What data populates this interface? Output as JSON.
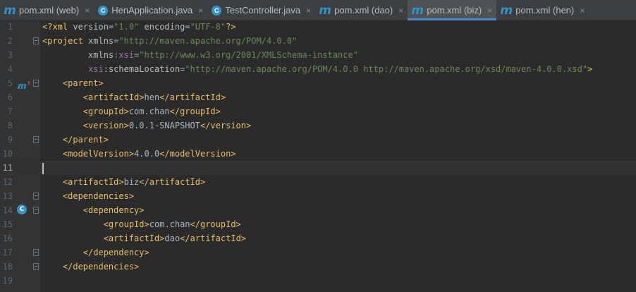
{
  "tabs": [
    {
      "label": "pom.xml (web)",
      "icon": "maven-icon",
      "active": false
    },
    {
      "label": "HenApplication.java",
      "icon": "spring-class-icon",
      "active": false
    },
    {
      "label": "TestController.java",
      "icon": "class-icon",
      "active": false
    },
    {
      "label": "pom.xml (dao)",
      "icon": "maven-icon",
      "active": false
    },
    {
      "label": "pom.xml (biz)",
      "icon": "maven-icon",
      "active": true
    },
    {
      "label": "pom.xml (hen)",
      "icon": "maven-icon",
      "active": false
    }
  ],
  "tab_close_glyph": "×",
  "tab_icon_m": "m",
  "tab_icon_c": "C",
  "current_line": 11,
  "line_numbers": [
    "1",
    "2",
    "3",
    "4",
    "5",
    "6",
    "7",
    "8",
    "9",
    "10",
    "11",
    "12",
    "13",
    "14",
    "15",
    "16",
    "17",
    "18",
    "19"
  ],
  "lines": {
    "l1": {
      "p1": "<?xml ",
      "a1": "version",
      "eq1": "=",
      "s1": "\"1.0\"",
      "a2": " encoding",
      "eq2": "=",
      "s2": "\"UTF-8\"",
      "p2": "?>"
    },
    "l2": {
      "t1": "<project ",
      "a1": "xmlns",
      "eq": "=",
      "s1": "\"http://maven.apache.org/POM/4.0.0\""
    },
    "l3": {
      "indent": "         ",
      "a1": "xmlns",
      "ns": ":xsi",
      "eq": "=",
      "s1": "\"http://www.w3.org/2001/XMLSchema-instance\""
    },
    "l4": {
      "indent": "         ",
      "ns": "xsi",
      "a1": ":schemaLocation",
      "eq": "=",
      "s1": "\"http://maven.apache.org/POM/4.0.0 http://maven.apache.org/xsd/maven-4.0.0.xsd\"",
      "t2": ">"
    },
    "l5": {
      "indent": "    ",
      "t1": "<parent>"
    },
    "l6": {
      "indent": "        ",
      "t1": "<artifactId>",
      "x": "hen",
      "t2": "</artifactId>"
    },
    "l7": {
      "indent": "        ",
      "t1": "<groupId>",
      "x": "com.chan",
      "t2": "</groupId>"
    },
    "l8": {
      "indent": "        ",
      "t1": "<version>",
      "x": "0.0.1-SNAPSHOT",
      "t2": "</version>"
    },
    "l9": {
      "indent": "    ",
      "t1": "</parent>"
    },
    "l10": {
      "indent": "    ",
      "t1": "<modelVersion>",
      "x": "4.0.0",
      "t2": "</modelVersion>"
    },
    "l12": {
      "indent": "    ",
      "t1": "<artifactId>",
      "x": "biz",
      "t2": "</artifactId>"
    },
    "l13": {
      "indent": "    ",
      "t1": "<dependencies>"
    },
    "l14": {
      "indent": "        ",
      "t1": "<dependency>"
    },
    "l15": {
      "indent": "            ",
      "t1": "<groupId>",
      "x": "com.chan",
      "t2": "</groupId>"
    },
    "l16": {
      "indent": "            ",
      "t1": "<artifactId>",
      "x": "dao",
      "t2": "</artifactId>"
    },
    "l17": {
      "indent": "        ",
      "t1": "</dependency>"
    },
    "l18": {
      "indent": "    ",
      "t1": "</dependencies>"
    }
  },
  "gutter_icons": {
    "line5": {
      "name": "maven-parent-override-icon",
      "glyph": "m",
      "mark": "↑"
    },
    "line14": {
      "name": "class-dependency-icon",
      "glyph": "C"
    }
  },
  "colors": {
    "background": "#2b2b2b",
    "gutter": "#313335",
    "tag": "#e8bf6a",
    "attribute": "#bababa",
    "namespace": "#9876aa",
    "string": "#6a8759",
    "text": "#a9b7c6",
    "accent": "#4a88c7"
  }
}
